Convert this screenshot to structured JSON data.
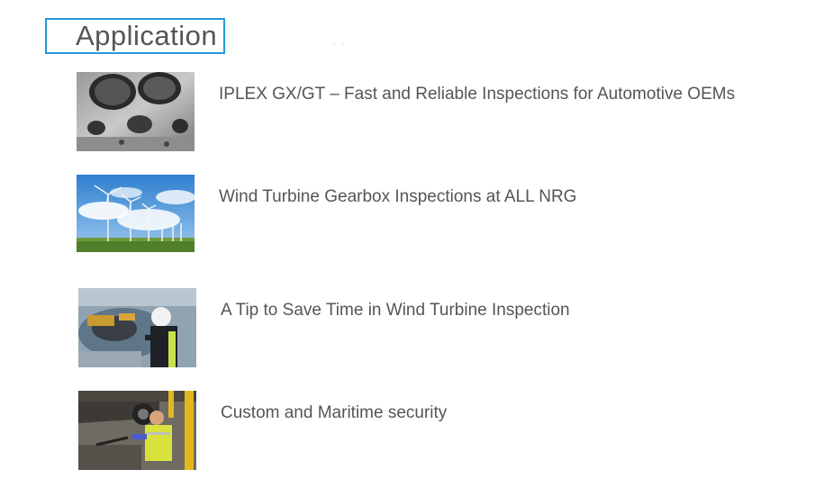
{
  "section": {
    "title": "Application"
  },
  "items": [
    {
      "title": "IPLEX GX/GT – Fast and Reliable Inspections for Automotive OEMs",
      "image": "engine-block-image"
    },
    {
      "title": "Wind Turbine Gearbox Inspections at ALL NRG",
      "image": "wind-turbines-image"
    },
    {
      "title": "A Tip to Save Time in Wind Turbine Inspection",
      "image": "technician-image"
    },
    {
      "title": "Custom and Maritime security",
      "image": "vehicle-inspection-image"
    }
  ],
  "colors": {
    "title_border": "#1f9ad6",
    "text": "#555555"
  }
}
